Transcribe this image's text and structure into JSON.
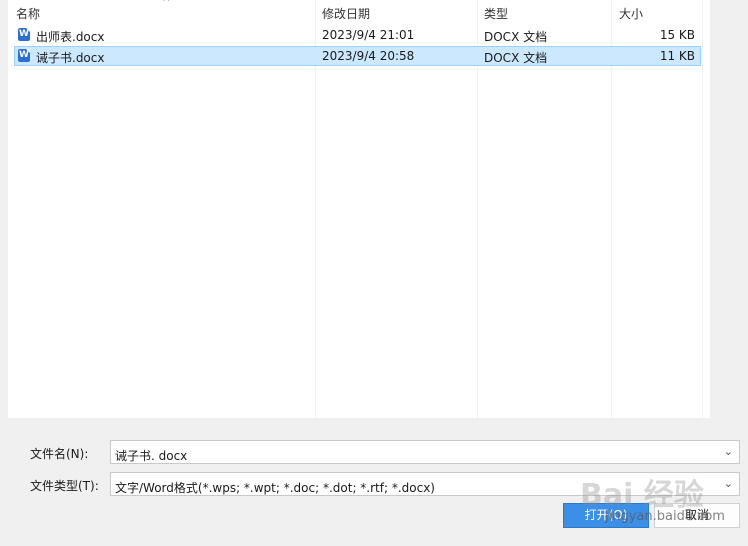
{
  "columns": {
    "name": "名称",
    "modified": "修改日期",
    "type": "类型",
    "size": "大小"
  },
  "files": [
    {
      "name": "出师表.docx",
      "modified": "2023/9/4 21:01",
      "type": "DOCX 文档",
      "size": "15 KB",
      "selected": false
    },
    {
      "name": "诫子书.docx",
      "modified": "2023/9/4 20:58",
      "type": "DOCX 文档",
      "size": "11 KB",
      "selected": true
    }
  ],
  "filename": {
    "label": "文件名(N):",
    "value": "诫子书. docx"
  },
  "filetype": {
    "label": "文件类型(T):",
    "value": "文字/Word格式(*.wps; *.wpt; *.doc; *.dot; *.rtf; *.docx)"
  },
  "buttons": {
    "open": "打开(O)",
    "cancel": "取消"
  },
  "watermark": {
    "main": "Bai 经验",
    "sub": "jingyan.baidu.com"
  },
  "icons": {
    "doc": "word-doc-icon",
    "sort": "sort-ascending-icon",
    "dropdown": "chevron-down-icon"
  }
}
